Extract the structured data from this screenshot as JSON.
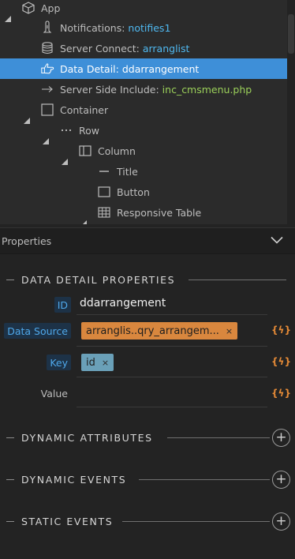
{
  "tree": [
    {
      "key": "app",
      "label": "App",
      "value": "",
      "value_color": "",
      "icon": "cube-icon",
      "twisty": "expanded"
    },
    {
      "key": "notifications",
      "label": "Notifications: ",
      "value": "notifies1",
      "value_color": "blue",
      "icon": "bell-icon",
      "twisty": ""
    },
    {
      "key": "server-connect",
      "label": "Server Connect: ",
      "value": "arranglist",
      "value_color": "blue",
      "icon": "database-icon",
      "twisty": ""
    },
    {
      "key": "data-detail",
      "label": "Data Detail: ddarrangement",
      "value": "",
      "value_color": "",
      "icon": "pointing-hand-icon",
      "twisty": "",
      "selected": true
    },
    {
      "key": "server-side-include",
      "label": "Server Side Include: ",
      "value": "inc_cmsmenu.php",
      "value_color": "green",
      "icon": "arrow-right-icon",
      "twisty": ""
    },
    {
      "key": "container",
      "label": "Container",
      "value": "",
      "value_color": "",
      "icon": "square-outline-icon",
      "twisty": "expanded"
    },
    {
      "key": "row",
      "label": "Row",
      "value": "",
      "value_color": "",
      "icon": "dots-icon",
      "twisty": "expanded"
    },
    {
      "key": "column",
      "label": "Column",
      "value": "",
      "value_color": "",
      "icon": "column-icon",
      "twisty": "expanded"
    },
    {
      "key": "title",
      "label": "Title",
      "value": "",
      "value_color": "",
      "icon": "dash-icon",
      "twisty": ""
    },
    {
      "key": "button",
      "label": "Button",
      "value": "",
      "value_color": "",
      "icon": "button-outline-icon",
      "twisty": ""
    },
    {
      "key": "responsive-table",
      "label": "Responsive Table",
      "value": "",
      "value_color": "",
      "icon": "table-grid-icon",
      "twisty": "expanded"
    }
  ],
  "properties_panel": {
    "title": "Properties",
    "collapse_icon": "chevron-down-icon"
  },
  "data_detail_section": {
    "title": "DATA DETAIL PROPERTIES",
    "fields": {
      "id": {
        "label": "ID",
        "value": "ddarrangement"
      },
      "data_source": {
        "label": "Data Source",
        "chip": "arranglis..qry_arrangem...",
        "chip_remove": "×",
        "bolt": "{ϟ}"
      },
      "key": {
        "label": "Key",
        "chip": "id",
        "chip_remove": "×",
        "bolt": "{ϟ}"
      },
      "value": {
        "label": "Value",
        "value": "",
        "bolt": "{ϟ}"
      }
    }
  },
  "sections": {
    "dynamic_attributes": {
      "title": "DYNAMIC ATTRIBUTES",
      "add": "+"
    },
    "dynamic_events": {
      "title": "DYNAMIC EVENTS",
      "add": "+"
    },
    "static_events": {
      "title": "STATIC EVENTS",
      "add": "+"
    }
  },
  "colors": {
    "selection": "#3e8fd8",
    "value_blue": "#4fb8f0",
    "value_green": "#9bd05a",
    "chip_orange": "#d9873e",
    "chip_teal": "#6aa0b8",
    "bolt_orange": "#e58a36"
  }
}
